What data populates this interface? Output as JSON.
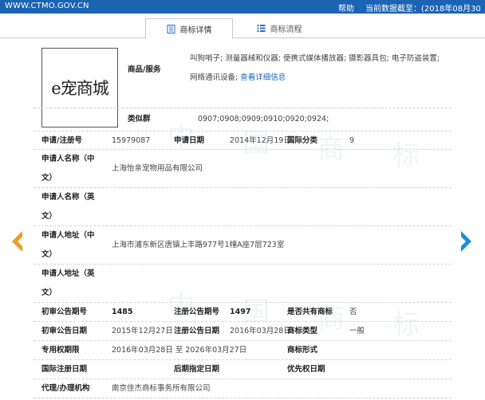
{
  "topbar": {
    "site": "WWW.CTMO.GOV.CN",
    "help": "帮助",
    "update_label": "当前数据截至：",
    "update_date": "(2018年08月30"
  },
  "tabs": [
    {
      "label": "商标详情",
      "active": true,
      "icon": "document-icon"
    },
    {
      "label": "商标流程",
      "active": false,
      "icon": "list-icon"
    }
  ],
  "logo": {
    "text": "e宠商城"
  },
  "goods": {
    "label": "商品/服务",
    "value": "叫狗哨子; 测量器械和仪器; 便携式媒体播放器; 摄影器具包; 电子防盗装置; 网络通讯设备;",
    "link": "查看详细信息"
  },
  "similar": {
    "label": "类似群",
    "value": "0907;0908;0909;0910;0920;0924;"
  },
  "reg": {
    "no_label": "申请/注册号",
    "no_value": "15979087",
    "date_label": "申请日期",
    "date_value": "2014年12月19日",
    "class_label": "国际分类",
    "class_value": "9"
  },
  "applicant_cn": {
    "label1": "申请人名称（中",
    "label2": "文）",
    "value": "上海怡亲宠物用品有限公司"
  },
  "applicant_en": {
    "label1": "申请人名称（英",
    "label2": "文）",
    "value": ""
  },
  "address_cn": {
    "label1": "申请人地址（中",
    "label2": "文）",
    "value": "上海市浦东新区唐镇上丰路977号1幢A座7层723室"
  },
  "address_en": {
    "label1": "申请人地址（英",
    "label2": "文）",
    "value": ""
  },
  "pub": {
    "prelim_no_label": "初审公告期号",
    "prelim_no_value": "1485",
    "reg_no_label": "注册公告期号",
    "reg_no_value": "1497",
    "shared_label": "是否共有商标",
    "shared_value": "否"
  },
  "pub_dates": {
    "prelim_date_label": "初审公告日期",
    "prelim_date_value": "2015年12月27日",
    "reg_date_label": "注册公告日期",
    "reg_date_value": "2016年03月28日",
    "type_label": "商标类型",
    "type_value": "一般"
  },
  "term": {
    "label": "专用权期限",
    "value": "2016年03月28日 至 2026年03月27日",
    "form_label": "商标形式",
    "form_value": ""
  },
  "intl": {
    "intl_label": "国际注册日期",
    "later_label": "后期指定日期",
    "priority_label": "优先权日期"
  },
  "agent": {
    "label": "代理/办理机构",
    "value": "南京佳杰商标事务所有限公司"
  },
  "watermark": [
    "中",
    "国",
    "商",
    "标"
  ],
  "colors": {
    "topbar": "#1b64b4",
    "arrow_left": "#f39a1e",
    "arrow_right": "#1b8fd6"
  }
}
